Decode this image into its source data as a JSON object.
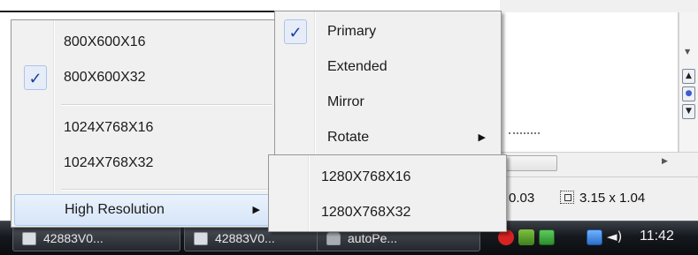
{
  "resolution_menu": {
    "items": [
      {
        "label": "800X600X16",
        "checked": false
      },
      {
        "label": "800X600X32",
        "checked": true
      },
      {
        "label": "1024X768X16",
        "checked": false
      },
      {
        "label": "1024X768X32",
        "checked": false
      }
    ],
    "high_resolution": {
      "label": "High Resolution",
      "arrow": "▶",
      "highlighted": true
    }
  },
  "display_mode_menu": {
    "items": [
      {
        "label": "Primary",
        "checked": true
      },
      {
        "label": "Extended",
        "checked": false
      },
      {
        "label": "Mirror",
        "checked": false
      }
    ],
    "rotate": {
      "label": "Rotate",
      "arrow": "▶"
    }
  },
  "high_resolution_submenu": {
    "items": [
      {
        "label": "1280X768X16"
      },
      {
        "label": "1280X768X32"
      }
    ]
  },
  "check_glyph": "✓",
  "status_bar": {
    "zoom": "0.03",
    "size": "3.15 x 1.04"
  },
  "taskbar": {
    "buttons": [
      {
        "label": "42883V0...",
        "icon": "document-icon"
      },
      {
        "label": "42883V0...",
        "icon": "document-icon"
      },
      {
        "label": "autoPe...",
        "icon": "printer-icon"
      }
    ],
    "clock": "11:42",
    "volume_glyph": "◄)"
  },
  "colors": {
    "menu_bg": "#f0f0f0",
    "check_color": "#1b3f9c",
    "highlight": "#d6e5f8",
    "taskbar": "#15181d"
  }
}
